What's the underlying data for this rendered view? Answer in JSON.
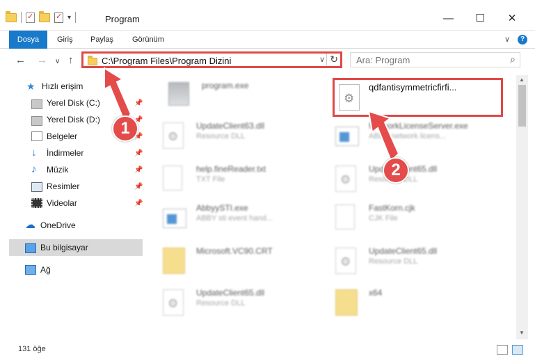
{
  "window": {
    "title": "Program",
    "minimize_label": "—",
    "maximize_label": "☐",
    "close_label": "✕"
  },
  "ribbon": {
    "tabs": [
      "Dosya",
      "Giriş",
      "Paylaş",
      "Görünüm"
    ],
    "expand_label": "∨",
    "help_label": "?"
  },
  "nav": {
    "back_label": "←",
    "forward_label": "→",
    "recent_label": "∨",
    "up_label": "↑",
    "address_path": "C:\\Program Files\\Program Dizini",
    "address_dropdown_label": "∨",
    "refresh_label": "↻",
    "search_placeholder": "Ara: Program",
    "search_icon_label": "⌕"
  },
  "sidebar": {
    "items": [
      {
        "label": "Hızlı erişim",
        "icon": "star-icon"
      },
      {
        "label": "Yerel Disk (C:)",
        "icon": "disk-icon",
        "pinned": true
      },
      {
        "label": "Yerel Disk (D:)",
        "icon": "disk-icon",
        "pinned": true
      },
      {
        "label": "Belgeler",
        "icon": "documents-icon",
        "pinned": true
      },
      {
        "label": "İndirmeler",
        "icon": "download-icon",
        "pinned": true
      },
      {
        "label": "Müzik",
        "icon": "music-icon",
        "pinned": true
      },
      {
        "label": "Resimler",
        "icon": "pictures-icon",
        "pinned": true
      },
      {
        "label": "Videolar",
        "icon": "videos-icon",
        "pinned": true
      },
      {
        "label": "OneDrive",
        "icon": "cloud-icon"
      },
      {
        "label": "Bu bilgisayar",
        "icon": "computer-icon",
        "selected": true
      },
      {
        "label": "Ağ",
        "icon": "network-icon"
      }
    ],
    "pin_glyph": "📌"
  },
  "files": {
    "left_column": [
      {
        "name": "program.exe",
        "sub": "",
        "icon": "program-icon"
      },
      {
        "name": "UpdateClient63.dll",
        "sub": "Resource DLL",
        "icon": "dll-icon"
      },
      {
        "name": "help.fineReader.txt",
        "sub": "TXT File",
        "icon": "text-file-icon"
      },
      {
        "name": "AbbyySTI.exe",
        "sub": "ABBY sti event hand...",
        "icon": "exe-icon"
      },
      {
        "name": "Microsoft.VC90.CRT",
        "sub": "",
        "icon": "folder-icon"
      },
      {
        "name": "UpdateClient65.dll",
        "sub": "Resource DLL",
        "icon": "dll-icon"
      }
    ],
    "right_column": [
      {
        "name": "qdfantisymmetricfirfi...",
        "sub": "",
        "icon": "gear-file-icon",
        "highlighted": true
      },
      {
        "name": "NetworkLicenseServer.exe",
        "sub": "ABBY network licens...",
        "icon": "exe-icon"
      },
      {
        "name": "UpdateClient65.dll",
        "sub": "Resource DLL",
        "icon": "dll-icon"
      },
      {
        "name": "FastKorn.cjk",
        "sub": "CJK File",
        "icon": "text-file-icon"
      },
      {
        "name": "UpdateClient65.dll",
        "sub": "Resource DLL",
        "icon": "dll-icon"
      },
      {
        "name": "x64",
        "sub": "",
        "icon": "folder-icon"
      }
    ]
  },
  "status": {
    "item_count": "131 öğe"
  },
  "callouts": {
    "one": "1",
    "two": "2"
  },
  "colors": {
    "accent": "#1979ca",
    "highlight_red": "#e04848",
    "selected_bg": "#d9d9d9"
  }
}
